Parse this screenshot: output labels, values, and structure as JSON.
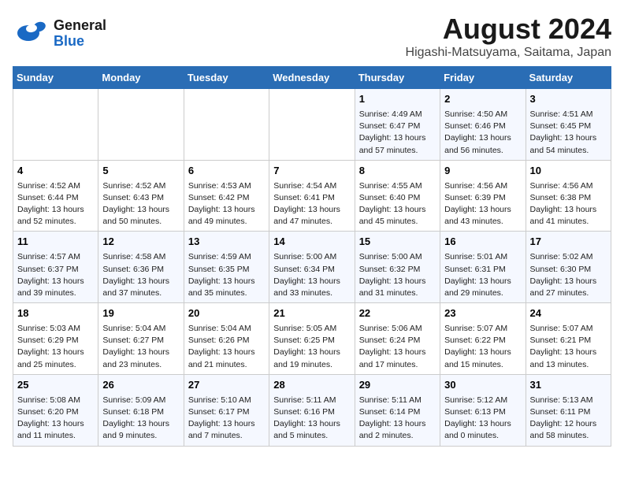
{
  "logo": {
    "line1": "General",
    "line2": "Blue"
  },
  "title": "August 2024",
  "subtitle": "Higashi-Matsuyama, Saitama, Japan",
  "days_of_week": [
    "Sunday",
    "Monday",
    "Tuesday",
    "Wednesday",
    "Thursday",
    "Friday",
    "Saturday"
  ],
  "weeks": [
    [
      {
        "day": "",
        "info": ""
      },
      {
        "day": "",
        "info": ""
      },
      {
        "day": "",
        "info": ""
      },
      {
        "day": "",
        "info": ""
      },
      {
        "day": "1",
        "info": "Sunrise: 4:49 AM\nSunset: 6:47 PM\nDaylight: 13 hours\nand 57 minutes."
      },
      {
        "day": "2",
        "info": "Sunrise: 4:50 AM\nSunset: 6:46 PM\nDaylight: 13 hours\nand 56 minutes."
      },
      {
        "day": "3",
        "info": "Sunrise: 4:51 AM\nSunset: 6:45 PM\nDaylight: 13 hours\nand 54 minutes."
      }
    ],
    [
      {
        "day": "4",
        "info": "Sunrise: 4:52 AM\nSunset: 6:44 PM\nDaylight: 13 hours\nand 52 minutes."
      },
      {
        "day": "5",
        "info": "Sunrise: 4:52 AM\nSunset: 6:43 PM\nDaylight: 13 hours\nand 50 minutes."
      },
      {
        "day": "6",
        "info": "Sunrise: 4:53 AM\nSunset: 6:42 PM\nDaylight: 13 hours\nand 49 minutes."
      },
      {
        "day": "7",
        "info": "Sunrise: 4:54 AM\nSunset: 6:41 PM\nDaylight: 13 hours\nand 47 minutes."
      },
      {
        "day": "8",
        "info": "Sunrise: 4:55 AM\nSunset: 6:40 PM\nDaylight: 13 hours\nand 45 minutes."
      },
      {
        "day": "9",
        "info": "Sunrise: 4:56 AM\nSunset: 6:39 PM\nDaylight: 13 hours\nand 43 minutes."
      },
      {
        "day": "10",
        "info": "Sunrise: 4:56 AM\nSunset: 6:38 PM\nDaylight: 13 hours\nand 41 minutes."
      }
    ],
    [
      {
        "day": "11",
        "info": "Sunrise: 4:57 AM\nSunset: 6:37 PM\nDaylight: 13 hours\nand 39 minutes."
      },
      {
        "day": "12",
        "info": "Sunrise: 4:58 AM\nSunset: 6:36 PM\nDaylight: 13 hours\nand 37 minutes."
      },
      {
        "day": "13",
        "info": "Sunrise: 4:59 AM\nSunset: 6:35 PM\nDaylight: 13 hours\nand 35 minutes."
      },
      {
        "day": "14",
        "info": "Sunrise: 5:00 AM\nSunset: 6:34 PM\nDaylight: 13 hours\nand 33 minutes."
      },
      {
        "day": "15",
        "info": "Sunrise: 5:00 AM\nSunset: 6:32 PM\nDaylight: 13 hours\nand 31 minutes."
      },
      {
        "day": "16",
        "info": "Sunrise: 5:01 AM\nSunset: 6:31 PM\nDaylight: 13 hours\nand 29 minutes."
      },
      {
        "day": "17",
        "info": "Sunrise: 5:02 AM\nSunset: 6:30 PM\nDaylight: 13 hours\nand 27 minutes."
      }
    ],
    [
      {
        "day": "18",
        "info": "Sunrise: 5:03 AM\nSunset: 6:29 PM\nDaylight: 13 hours\nand 25 minutes."
      },
      {
        "day": "19",
        "info": "Sunrise: 5:04 AM\nSunset: 6:27 PM\nDaylight: 13 hours\nand 23 minutes."
      },
      {
        "day": "20",
        "info": "Sunrise: 5:04 AM\nSunset: 6:26 PM\nDaylight: 13 hours\nand 21 minutes."
      },
      {
        "day": "21",
        "info": "Sunrise: 5:05 AM\nSunset: 6:25 PM\nDaylight: 13 hours\nand 19 minutes."
      },
      {
        "day": "22",
        "info": "Sunrise: 5:06 AM\nSunset: 6:24 PM\nDaylight: 13 hours\nand 17 minutes."
      },
      {
        "day": "23",
        "info": "Sunrise: 5:07 AM\nSunset: 6:22 PM\nDaylight: 13 hours\nand 15 minutes."
      },
      {
        "day": "24",
        "info": "Sunrise: 5:07 AM\nSunset: 6:21 PM\nDaylight: 13 hours\nand 13 minutes."
      }
    ],
    [
      {
        "day": "25",
        "info": "Sunrise: 5:08 AM\nSunset: 6:20 PM\nDaylight: 13 hours\nand 11 minutes."
      },
      {
        "day": "26",
        "info": "Sunrise: 5:09 AM\nSunset: 6:18 PM\nDaylight: 13 hours\nand 9 minutes."
      },
      {
        "day": "27",
        "info": "Sunrise: 5:10 AM\nSunset: 6:17 PM\nDaylight: 13 hours\nand 7 minutes."
      },
      {
        "day": "28",
        "info": "Sunrise: 5:11 AM\nSunset: 6:16 PM\nDaylight: 13 hours\nand 5 minutes."
      },
      {
        "day": "29",
        "info": "Sunrise: 5:11 AM\nSunset: 6:14 PM\nDaylight: 13 hours\nand 2 minutes."
      },
      {
        "day": "30",
        "info": "Sunrise: 5:12 AM\nSunset: 6:13 PM\nDaylight: 13 hours\nand 0 minutes."
      },
      {
        "day": "31",
        "info": "Sunrise: 5:13 AM\nSunset: 6:11 PM\nDaylight: 12 hours\nand 58 minutes."
      }
    ]
  ]
}
